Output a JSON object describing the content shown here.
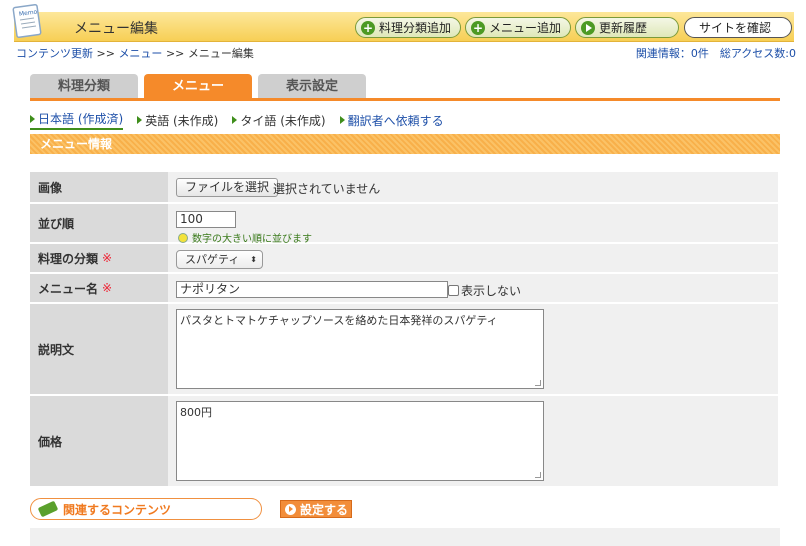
{
  "header": {
    "title": "メニュー編集",
    "memo_icon_label": "Memo",
    "buttons": {
      "add_category": "料理分類追加",
      "add_menu": "メニュー追加",
      "history": "更新履歴",
      "view_site": "サイトを確認"
    }
  },
  "breadcrumb": {
    "item1": "コンテンツ更新",
    "sep": ">>",
    "item2": "メニュー",
    "item3": "メニュー編集"
  },
  "related_info": "関連情報：0件　総アクセス数:0",
  "tabs": {
    "category": "料理分類",
    "menu": "メニュー",
    "display": "表示設定"
  },
  "languages": {
    "japanese": "日本語 (作成済)",
    "english": "英語 (未作成)",
    "thai": "タイ語 (未作成)",
    "request": "翻訳者へ依頼する"
  },
  "section_title": "メニュー情報",
  "form": {
    "image": {
      "label": "画像",
      "button": "ファイルを選択",
      "status": "選択されていません"
    },
    "order": {
      "label": "並び順",
      "value": "100",
      "hint": "数字の大きい順に並びます"
    },
    "category": {
      "label": "料理の分類",
      "required": "※",
      "selected": "スパゲティ"
    },
    "name": {
      "label": "メニュー名",
      "required": "※",
      "value": "ナポリタン",
      "hide_label": "表示しない"
    },
    "description": {
      "label": "説明文",
      "value": "パスタとトマトケチャップソースを絡めた日本発祥のスパゲティ"
    },
    "price": {
      "label": "価格",
      "value": "800円"
    }
  },
  "footer": {
    "related_button": "関連するコンテンツ",
    "submit_button": "設定する"
  },
  "colors": {
    "accent": "#f58a2a",
    "header_bg": "#f7cf55",
    "link": "#1d4fa8",
    "green": "#4d9a24"
  }
}
